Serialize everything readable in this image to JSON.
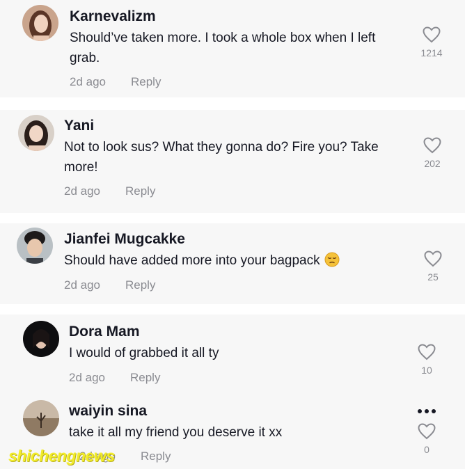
{
  "comments": [
    {
      "username": "Karnevalizm",
      "text": "Should’ve taken more. I took a whole box when I left grab.",
      "time": "2d ago",
      "reply_label": "Reply",
      "likes": "1214"
    },
    {
      "username": "Yani",
      "text": "Not to look sus? What they gonna do? Fire you? Take more!",
      "time": "2d ago",
      "reply_label": "Reply",
      "likes": "202"
    },
    {
      "username": "Jianfei Mugcakke",
      "text": "Should have added more into your bagpack",
      "emoji": "pensive-face-icon",
      "time": "2d ago",
      "reply_label": "Reply",
      "likes": "25"
    },
    {
      "username": "Dora Mam",
      "text": "I would of grabbed it all ty",
      "time": "2d ago",
      "reply_label": "Reply",
      "likes": "10"
    },
    {
      "username": "waiyin sina",
      "text": "take it all my friend you deserve it xx",
      "time": "2d ago",
      "reply_label": "Reply",
      "likes": "0"
    }
  ],
  "icons": {
    "like": "heart-outline-icon",
    "more": "more-options-icon"
  },
  "colors": {
    "card_bg": "#f7f7f7",
    "text": "#161823",
    "muted": "#8a8b91",
    "watermark": "#f2ec2a"
  },
  "watermark": "shichengnews"
}
